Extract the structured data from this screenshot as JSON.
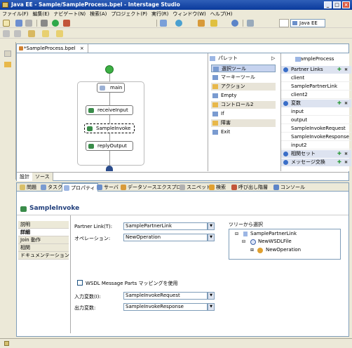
{
  "window": {
    "title": "Java EE - Sample/SampleProcess.bpel - Interstage Studio",
    "minimize": "_",
    "maximize": "□",
    "close": "×"
  },
  "menu": [
    "ファイル(F)",
    "編集(E)",
    "ナビゲート(N)",
    "検索(A)",
    "プロジェクト(P)",
    "実行(R)",
    "ウィンドウ(W)",
    "ヘルプ(H)"
  ],
  "perspective": {
    "label": "Java EE"
  },
  "editor": {
    "tab_label": "*SampleProcess.bpel",
    "tab_close": "×",
    "nodes": {
      "main": "main",
      "receive": "receiveInput",
      "invoke": "SampleInvoke",
      "reply": "replyOutput"
    },
    "bottom_tabs": [
      "設計",
      "ソース"
    ]
  },
  "palette": {
    "title": "パレット",
    "items": [
      {
        "kind": "item",
        "label": "選択ツール"
      },
      {
        "kind": "item",
        "label": "マーキーツール"
      },
      {
        "kind": "header",
        "label": "アクション"
      },
      {
        "kind": "item",
        "label": "Empty"
      },
      {
        "kind": "header",
        "label": "コントロール2"
      },
      {
        "kind": "item",
        "label": "If"
      },
      {
        "kind": "header",
        "label": "障害"
      },
      {
        "kind": "item",
        "label": "Exit"
      }
    ]
  },
  "outline": {
    "title": "SampleProcess",
    "rows": [
      {
        "kind": "header",
        "label": "Partner Links"
      },
      {
        "kind": "item",
        "label": "client"
      },
      {
        "kind": "item",
        "label": "SamplePartnerLink"
      },
      {
        "kind": "item",
        "label": "client2"
      },
      {
        "kind": "header",
        "label": "変数"
      },
      {
        "kind": "item",
        "label": "input"
      },
      {
        "kind": "item",
        "label": "output"
      },
      {
        "kind": "item",
        "label": "SampleInvokeRequest"
      },
      {
        "kind": "item",
        "label": "SampleInvokeResponse"
      },
      {
        "kind": "item",
        "label": "input2"
      },
      {
        "kind": "header",
        "label": "相関セット"
      },
      {
        "kind": "header",
        "label": "メッセージ交換"
      }
    ]
  },
  "views": {
    "tabs": [
      "問題",
      "タスク",
      "プロパティ",
      "サーバ",
      "データソースエクスプロ",
      "スニペット",
      "検索",
      "呼び出し階層",
      "コンソール"
    ],
    "active_index": 2
  },
  "properties": {
    "title": "SampleInvoke",
    "side_tabs": [
      "説明",
      "詳細",
      "Join 動作",
      "相関",
      "ドキュメンテーション"
    ],
    "active_side_tab": 1,
    "partner_link_label": "Partner Link(T):",
    "partner_link_value": "SamplePartnerLink",
    "operation_label": "オペレーション:",
    "operation_value": "NewOperation",
    "tree_label": "ツリーから選択",
    "tree": [
      "SamplePartnerLink",
      "NewWSDLFile",
      "NewOperation"
    ],
    "wsdl_checkbox_label": "WSDL Message Parts マッピングを使用",
    "input_var_label": "入力変数(I):",
    "input_var_value": "SampleInvokeRequest",
    "output_var_label": "出力変数:",
    "output_var_value": "SampleInvokeResponse"
  },
  "colors": {
    "titlebar": "#0a3a9c",
    "selection": "#c6d3ef",
    "accent_green": "#3cb043"
  }
}
